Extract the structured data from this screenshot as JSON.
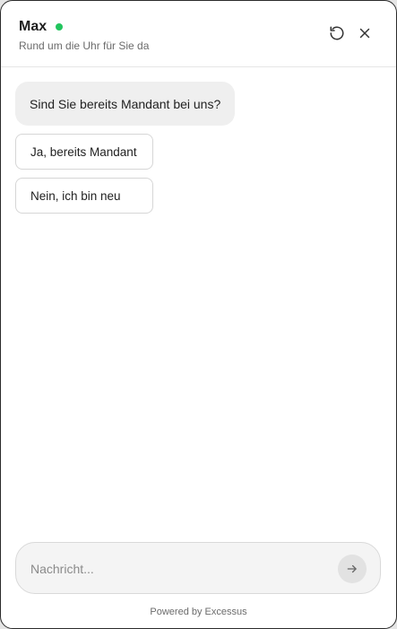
{
  "header": {
    "agent_name": "Max",
    "status": "online",
    "subtitle": "Rund um die Uhr für Sie da",
    "status_color": "#22c55e",
    "reset_icon": "reset-icon",
    "close_icon": "close-icon"
  },
  "messages": [
    {
      "sender": "bot",
      "text": "Sind Sie bereits Mandant bei uns?"
    }
  ],
  "quick_replies": [
    {
      "label": "Ja, bereits Mandant"
    },
    {
      "label": "Nein, ich bin neu"
    }
  ],
  "composer": {
    "placeholder": "Nachricht...",
    "value": "",
    "send_icon": "arrow-right-icon"
  },
  "footer": {
    "text": "Powered by Excessus"
  }
}
